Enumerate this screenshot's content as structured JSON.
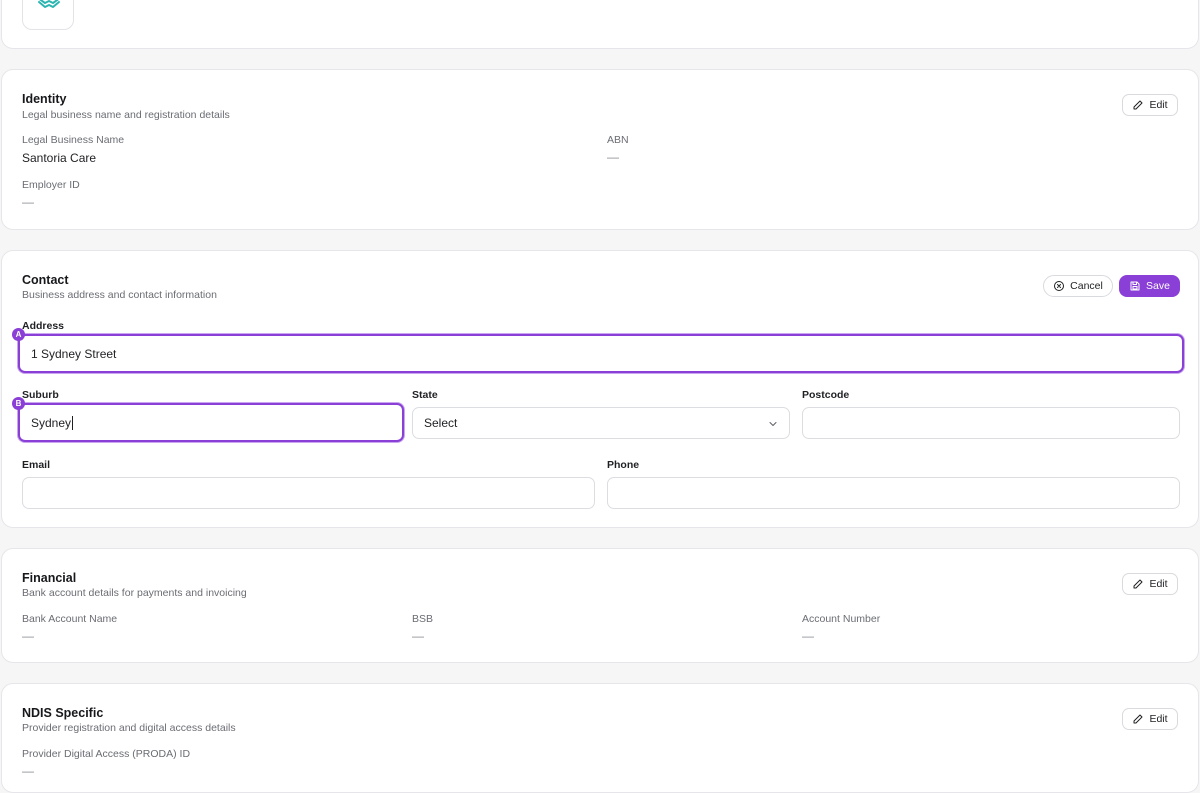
{
  "identity": {
    "title": "Identity",
    "subtitle": "Legal business name and registration details",
    "edit_label": "Edit",
    "fields": {
      "legal_name_label": "Legal Business Name",
      "legal_name_value": "Santoria Care",
      "abn_label": "ABN",
      "abn_value": "—",
      "employer_id_label": "Employer ID",
      "employer_id_value": "—"
    }
  },
  "contact": {
    "title": "Contact",
    "subtitle": "Business address and contact information",
    "cancel_label": "Cancel",
    "save_label": "Save",
    "address_label": "Address",
    "address_value": "1 Sydney Street",
    "address_marker": "A",
    "suburb_label": "Suburb",
    "suburb_value": "Sydney",
    "suburb_marker": "B",
    "state_label": "State",
    "state_value": "Select",
    "postcode_label": "Postcode",
    "postcode_value": "",
    "email_label": "Email",
    "email_value": "",
    "phone_label": "Phone",
    "phone_value": ""
  },
  "financial": {
    "title": "Financial",
    "subtitle": "Bank account details for payments and invoicing",
    "edit_label": "Edit",
    "bank_name_label": "Bank Account Name",
    "bank_name_value": "—",
    "bsb_label": "BSB",
    "bsb_value": "—",
    "account_number_label": "Account Number",
    "account_number_value": "—"
  },
  "ndis": {
    "title": "NDIS Specific",
    "subtitle": "Provider registration and digital access details",
    "edit_label": "Edit",
    "proda_label": "Provider Digital Access (PRODA) ID",
    "proda_value": "—"
  },
  "colors": {
    "accent": "#8a3fd6",
    "logo_teal": "#2bb5b0"
  },
  "icons": {
    "logo": "hands-heart-logo",
    "edit": "pencil-icon",
    "cancel": "x-circle-icon",
    "save": "floppy-disk-icon",
    "dropdown": "chevron-down-icon"
  }
}
